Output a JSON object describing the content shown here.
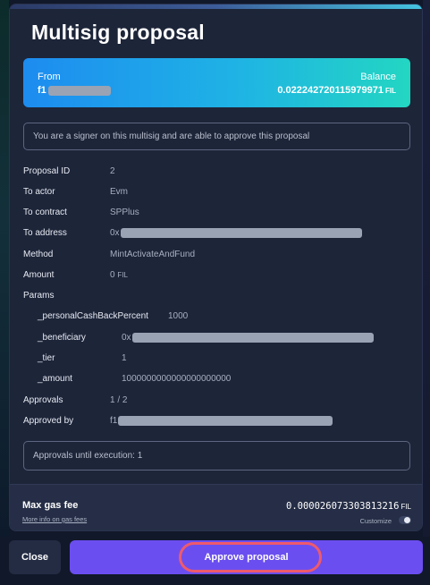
{
  "title": "Multisig proposal",
  "balance_card": {
    "from_label": "From",
    "from_address_prefix": "f1",
    "balance_label": "Balance",
    "balance_value": "0.022242720115979971",
    "balance_unit": "FIL"
  },
  "signer_notice": "You are a signer on this multisig and are able to approve this proposal",
  "details": {
    "proposal_id": {
      "label": "Proposal ID",
      "value": "2"
    },
    "to_actor": {
      "label": "To actor",
      "value": "Evm"
    },
    "to_contract": {
      "label": "To contract",
      "value": "SPPlus"
    },
    "to_address": {
      "label": "To address",
      "value_prefix": "0x"
    },
    "method": {
      "label": "Method",
      "value": "MintActivateAndFund"
    },
    "amount": {
      "label": "Amount",
      "value": "0",
      "unit": "FIL"
    },
    "params_label": "Params",
    "params": {
      "cashback": {
        "label": "_personalCashBackPercent",
        "value": "1000"
      },
      "beneficiary": {
        "label": "_beneficiary",
        "value_prefix": "0x"
      },
      "tier": {
        "label": "_tier",
        "value": "1"
      },
      "amount": {
        "label": "_amount",
        "value": "1000000000000000000000"
      }
    },
    "approvals": {
      "label": "Approvals",
      "value": "1 / 2"
    },
    "approved_by": {
      "label": "Approved by",
      "value_prefix": "f1"
    }
  },
  "approvals_until_execution": "Approvals until execution: 1",
  "gas": {
    "label": "Max gas fee",
    "value": "0.000026073303813216",
    "unit": "FIL",
    "more_info_link": "More info on gas fees",
    "customize_label": "Customize"
  },
  "buttons": {
    "close": "Close",
    "approve": "Approve proposal"
  },
  "colors": {
    "accent": "#6b4ef0",
    "highlight": "#ef5a6b",
    "card_gradient_start": "#1d8cf0",
    "card_gradient_end": "#23d6c2"
  }
}
